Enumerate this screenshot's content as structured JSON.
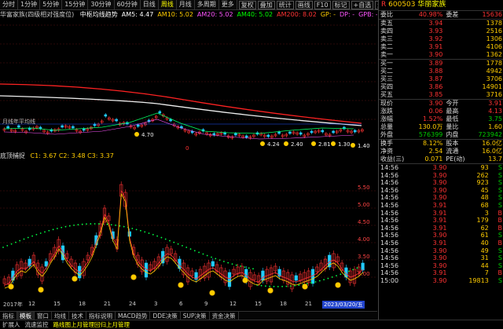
{
  "toolbar": {
    "periods": [
      "分时",
      "1分钟",
      "5分钟",
      "15分钟",
      "30分钟",
      "60分钟",
      "日线",
      "周线",
      "月线",
      "多周期",
      "更多"
    ],
    "selected_period": "周线",
    "tools": [
      "复权",
      "叠加",
      "统计",
      "画线",
      "F10",
      "标记",
      "+自选",
      "返回"
    ]
  },
  "indicators": {
    "title": "华富家族(四级相对强度位)",
    "items": [
      {
        "label": "中枢均线趋势",
        "color": "#ffffff"
      },
      {
        "label": "AM5: 4.47",
        "color": "#ffffff"
      },
      {
        "label": "AM10: 5.02",
        "color": "#ffcc00"
      },
      {
        "label": "AM20: 5.02",
        "color": "#ff55ff"
      },
      {
        "label": "AM40: 5.02",
        "color": "#00ff00"
      },
      {
        "label": "AM200: 8.02",
        "color": "#ff3333"
      },
      {
        "label": "GP: -",
        "color": "#ffcc00"
      },
      {
        "label": "DP: -",
        "color": "#ff55ff"
      },
      {
        "label": "GPB: -",
        "color": "#ff55ff"
      },
      {
        "label": "DPB: -",
        "color": "#ff55ff"
      },
      {
        "label": "L1: -",
        "color": "#22ccff"
      },
      {
        "label": "L2: -",
        "color": "#22ccff"
      }
    ]
  },
  "main_chart": {
    "y_ticks": [
      "14.00",
      "12.00",
      "10.00",
      "8.00",
      "6.00",
      "4.00"
    ],
    "price_tag": "9.40",
    "annotations": [
      "4.70",
      "4.24",
      "2.40",
      "2.81",
      "1.30",
      "1.40"
    ],
    "marker_note": "月线年平均线",
    "zero_label": "0"
  },
  "sub_chart": {
    "title": "底顶捕捉",
    "values": "C1: 3.67  C2: 3.48  C3: 3.37",
    "y_ticks": [
      "5.50",
      "5.00",
      "4.50",
      "4.00",
      "3.50",
      "3.00"
    ]
  },
  "x_axis": {
    "labels": [
      "2017年",
      "12",
      "15",
      "18",
      "21",
      "24",
      "3",
      "6",
      "9",
      "12",
      "15",
      "18",
      "21",
      "24"
    ],
    "highlight": "2023/03/20/五"
  },
  "tabs": [
    "指标",
    "模板",
    "窗口",
    "均线",
    "技术",
    "指标说明",
    "MACD趋势",
    "DDE决策",
    "SUP决策",
    "资金决策"
  ],
  "status_bar": [
    "扩展人",
    "流速监控",
    "路线图上月管理回归上月管理"
  ],
  "stock": {
    "code": "600503",
    "name": "华丽家族"
  },
  "order_book": {
    "header": {
      "label": "委比",
      "ratio": "40.98%",
      "diff_label": "委差",
      "diff": "15636"
    },
    "asks": [
      {
        "label": "卖五",
        "price": "3.94",
        "vol": "1378"
      },
      {
        "label": "卖四",
        "price": "3.93",
        "vol": "2516"
      },
      {
        "label": "卖三",
        "price": "3.92",
        "vol": "1306"
      },
      {
        "label": "卖二",
        "price": "3.91",
        "vol": "4106"
      },
      {
        "label": "卖一",
        "price": "3.90",
        "vol": "1362"
      }
    ],
    "bids": [
      {
        "label": "买一",
        "price": "3.89",
        "vol": "1778"
      },
      {
        "label": "买二",
        "price": "3.88",
        "vol": "4942"
      },
      {
        "label": "买三",
        "price": "3.87",
        "vol": "3706"
      },
      {
        "label": "买四",
        "price": "3.86",
        "vol": "14901"
      },
      {
        "label": "买五",
        "price": "3.85",
        "vol": "3716"
      }
    ]
  },
  "quote": [
    {
      "l1": "现价",
      "v1": "3.90",
      "l2": "今开",
      "v2": "3.91"
    },
    {
      "l1": "涨跌",
      "v1": "0.06",
      "l2": "最高",
      "v2": "4.13"
    },
    {
      "l1": "涨幅",
      "v1": "1.52%",
      "l2": "最低",
      "v2": "3.75"
    },
    {
      "l1": "总量",
      "v1": "130.0万",
      "l2": "量比",
      "v2": "1.60"
    },
    {
      "l1": "外盘",
      "v1": "576399",
      "l2": "内盘",
      "v2": "723942"
    },
    {
      "l1": "换手",
      "v1": "8.12%",
      "l2": "股本",
      "v2": "16.0亿"
    },
    {
      "l1": "净资",
      "v1": "2.54",
      "l2": "流通",
      "v2": "16.0亿"
    },
    {
      "l1": "收益(三)",
      "v1": "0.071",
      "l2": "PE(动)",
      "v2": "13.7"
    }
  ],
  "trades": [
    {
      "t": "14:56",
      "p": "3.90",
      "v": "93",
      "d": "S"
    },
    {
      "t": "14:56",
      "p": "3.90",
      "v": "262",
      "d": "S"
    },
    {
      "t": "14:56",
      "p": "3.90",
      "v": "923",
      "d": "S"
    },
    {
      "t": "14:56",
      "p": "3.90",
      "v": "45",
      "d": "S"
    },
    {
      "t": "14:56",
      "p": "3.90",
      "v": "48",
      "d": "S"
    },
    {
      "t": "14:56",
      "p": "3.91",
      "v": "68",
      "d": "S"
    },
    {
      "t": "14:56",
      "p": "3.91",
      "v": "3",
      "d": "B"
    },
    {
      "t": "14:56",
      "p": "3.91",
      "v": "179",
      "d": "B"
    },
    {
      "t": "14:56",
      "p": "3.91",
      "v": "62",
      "d": "B"
    },
    {
      "t": "14:56",
      "p": "3.90",
      "v": "61",
      "d": "S"
    },
    {
      "t": "14:56",
      "p": "3.91",
      "v": "40",
      "d": "B"
    },
    {
      "t": "14:56",
      "p": "3.90",
      "v": "49",
      "d": "S"
    },
    {
      "t": "14:56",
      "p": "3.90",
      "v": "31",
      "d": "S"
    },
    {
      "t": "14:56",
      "p": "3.90",
      "v": "44",
      "d": "S"
    },
    {
      "t": "14:56",
      "p": "3.91",
      "v": "7",
      "d": "B"
    },
    {
      "t": "15:00",
      "p": "3.90",
      "v": "19813",
      "d": "S"
    }
  ],
  "colors": {
    "up": "#ff3333",
    "down": "#00cc00",
    "accent": "#ffcc00",
    "cyan": "#22ccff"
  }
}
